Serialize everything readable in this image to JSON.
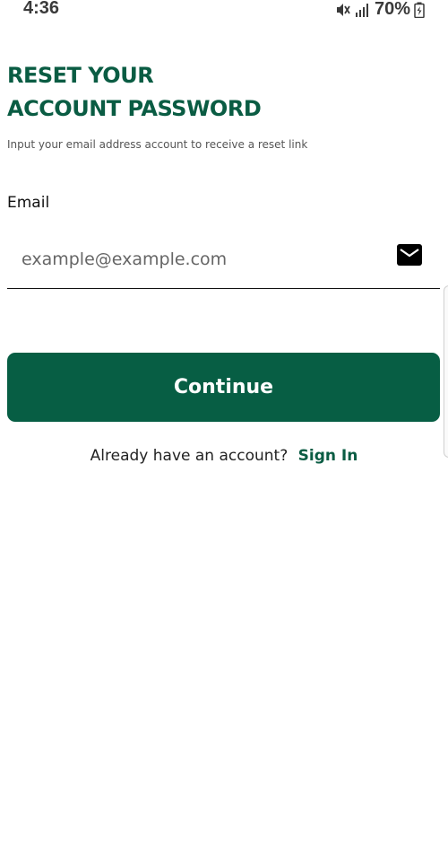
{
  "status_bar": {
    "time": "4:36",
    "battery": "70%",
    "icons": [
      "mute-icon",
      "signal-icon",
      "battery-charging-icon"
    ]
  },
  "header": {
    "title_line1": "RESET YOUR",
    "title_line2": "ACCOUNT PASSWORD",
    "subtitle": "Input your email address account to receive a reset link"
  },
  "form": {
    "email_label": "Email",
    "email_placeholder": "example@example.com",
    "email_value": "",
    "email_icon": "mail-icon",
    "continue_label": "Continue"
  },
  "footer": {
    "prompt": "Already have an account?",
    "signin_label": "Sign In"
  },
  "colors": {
    "brand": "#075e44",
    "title": "#0a5c43",
    "background": "#ffffff"
  }
}
